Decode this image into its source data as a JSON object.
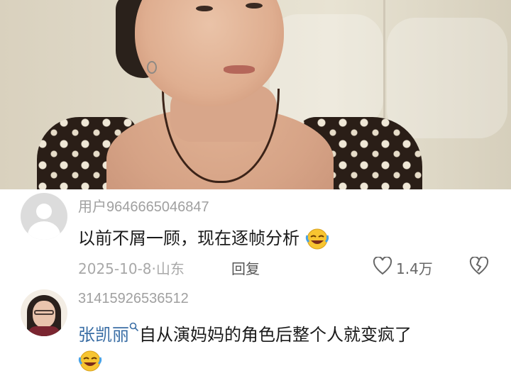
{
  "icons": {
    "default_avatar": "default-avatar-icon",
    "user_avatar": "user-avatar-photo",
    "like": "heart-outline-icon",
    "dislike": "broken-heart-icon",
    "emoji": "rofl-face-emoji",
    "mention_search": "search-icon"
  },
  "colors": {
    "mention": "#3a6ea5",
    "meta_gray": "#a8a8a8",
    "text": "#1a1a1a"
  },
  "comments": [
    {
      "username": "用户9646665046847",
      "text": "以前不屑一顾，现在逐帧分析",
      "date_location": "2025-10-8·山东",
      "reply_label": "回复",
      "likes": "1.4万"
    },
    {
      "username": "31415926536512",
      "mention": "张凯丽",
      "text": "自从演妈妈的角色后整个人就变疯了"
    }
  ]
}
